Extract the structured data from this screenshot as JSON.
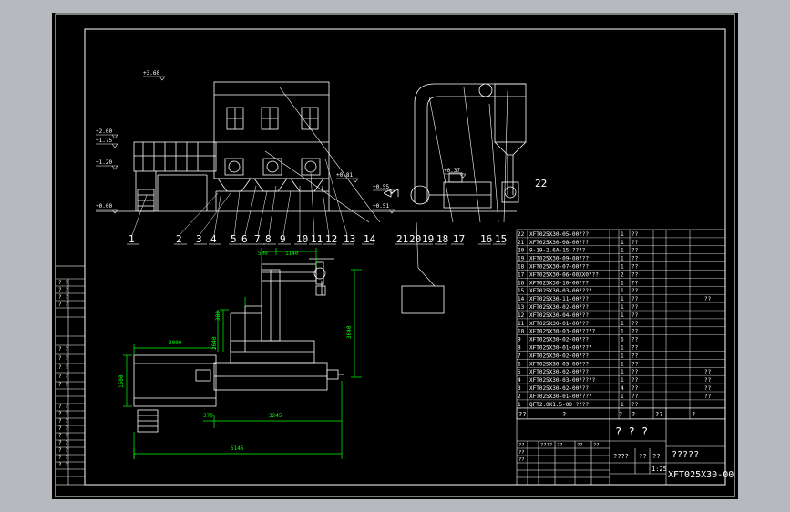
{
  "drawing": {
    "title_cells": [
      "? ? ?",
      "?????",
      "????",
      "??",
      "??",
      "1:25"
    ],
    "drawing_number": "XFT025X30-00",
    "colors": {
      "background": "#000000",
      "line": "#ffffff",
      "dimension": "#00ff00",
      "leader": "#ffffff",
      "frame": "#ffffff"
    }
  },
  "elevation": {
    "level_marks": [
      "+3.60",
      "+2.00",
      "+1.75",
      "+1.20",
      "+0.00",
      "+0.81",
      "+0.55",
      "+0.51",
      "+0.37"
    ],
    "part_numbers": [
      "1",
      "2",
      "3",
      "4",
      "5",
      "6",
      "7",
      "8",
      "9",
      "10",
      "11",
      "12",
      "13",
      "14",
      "21",
      "20",
      "19",
      "18",
      "17",
      "16",
      "15",
      "22"
    ]
  },
  "plan": {
    "dimensions": [
      "500",
      "1140",
      "3000",
      "1500",
      "380",
      "3640",
      "3245",
      "370",
      "2640",
      "5145"
    ]
  },
  "parts_list": {
    "rows": [
      {
        "no": "22",
        "code": "XFT025X30-05-00???",
        "qty": "1",
        "mat": "??",
        "note": ""
      },
      {
        "no": "21",
        "code": "XFT025X30-08-00???",
        "qty": "1",
        "mat": "??",
        "note": ""
      },
      {
        "no": "20",
        "code": "9-19-2.6A-15 ????",
        "qty": "1",
        "mat": "??",
        "note": ""
      },
      {
        "no": "19",
        "code": "XFT025X30-09-00???",
        "qty": "1",
        "mat": "??",
        "note": ""
      },
      {
        "no": "18",
        "code": "XFT025X30-07-00???",
        "qty": "1",
        "mat": "??",
        "note": ""
      },
      {
        "no": "17",
        "code": "XFT025X30-06-00XX0???",
        "qty": "2",
        "mat": "??",
        "note": ""
      },
      {
        "no": "16",
        "code": "XFT025X30-10-00???",
        "qty": "1",
        "mat": "??",
        "note": ""
      },
      {
        "no": "15",
        "code": "XFT025X30-03-00????",
        "qty": "1",
        "mat": "??",
        "note": ""
      },
      {
        "no": "14",
        "code": "XFT025X30-11-00???",
        "qty": "1",
        "mat": "??",
        "note": "??"
      },
      {
        "no": "13",
        "code": "XFT025X30-02-00???",
        "qty": "1",
        "mat": "??",
        "note": ""
      },
      {
        "no": "12",
        "code": "XFT025X30-04-00???",
        "qty": "1",
        "mat": "??",
        "note": ""
      },
      {
        "no": "11",
        "code": "XFT025X30-01-00???",
        "qty": "1",
        "mat": "??",
        "note": ""
      },
      {
        "no": "10",
        "code": "XFT025X30-03-00?????",
        "qty": "1",
        "mat": "??",
        "note": ""
      },
      {
        "no": "9",
        "code": "XFT025X30-02-00???",
        "qty": "6",
        "mat": "??",
        "note": ""
      },
      {
        "no": "8",
        "code": "XFT025X30-01-00????",
        "qty": "1",
        "mat": "??",
        "note": ""
      },
      {
        "no": "7",
        "code": "XFT025X30-02-00???",
        "qty": "1",
        "mat": "??",
        "note": ""
      },
      {
        "no": "6",
        "code": "XFT025X30-03-00???",
        "qty": "1",
        "mat": "??",
        "note": ""
      },
      {
        "no": "5",
        "code": "XFT025X30-02-00???",
        "qty": "1",
        "mat": "??",
        "note": "??"
      },
      {
        "no": "4",
        "code": "XFT025X30-03-00?????",
        "qty": "1",
        "mat": "??",
        "note": "??"
      },
      {
        "no": "3",
        "code": "XFT025X30-02-00???",
        "qty": "4",
        "mat": "??",
        "note": "??"
      },
      {
        "no": "2",
        "code": "XFT025X30-01-00????",
        "qty": "1",
        "mat": "??",
        "note": "??"
      },
      {
        "no": "1",
        "code": "QFT2.0X1.5-00 ????",
        "qty": "1",
        "mat": "??",
        "note": ""
      }
    ],
    "header": [
      "??",
      "?",
      "?",
      "?",
      "??",
      "?"
    ]
  },
  "left_strip": {
    "groups": [
      [
        "? ?",
        "? ?",
        "? ?",
        "? ?"
      ],
      [
        "? ?",
        "? ?",
        "? ?",
        "? ?",
        "? ?"
      ],
      [
        "? ?",
        "? ?",
        "? ?",
        "? ?",
        "? ?",
        "? ?",
        "? ?",
        "? ?",
        "? ?"
      ]
    ]
  },
  "revision_block": {
    "cells": [
      "??",
      "??",
      "????",
      "??",
      "??",
      "??",
      "??"
    ]
  }
}
